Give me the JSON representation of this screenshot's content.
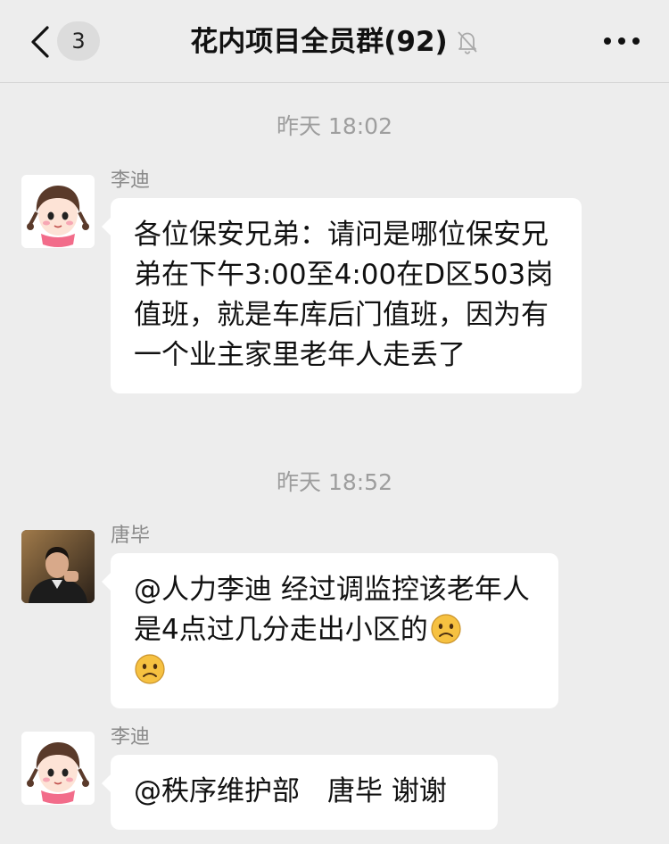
{
  "header": {
    "unread_count": "3",
    "title": "花内项目全员群(92)",
    "back_icon": "chevron-left-icon",
    "mute_icon": "bell-off-icon",
    "more_icon": "more-dots-icon"
  },
  "messages": [
    {
      "timestamp": "昨天 18:02"
    },
    {
      "sender": "李迪",
      "avatar": "girl-cartoon-avatar",
      "text": "各位保安兄弟：请问是哪位保安兄弟在下午3:00至4:00在D区503岗值班，就是车库后门值班，因为有一个业主家里老年人走丢了"
    },
    {
      "timestamp": "昨天 18:52"
    },
    {
      "sender": "唐毕",
      "avatar": "man-photo-avatar",
      "text": "@人力李迪 经过调监控该老年人是4点过几分走出小区的",
      "emoji": [
        "frown-emoji",
        "frown-emoji"
      ]
    },
    {
      "sender": "李迪",
      "avatar": "girl-cartoon-avatar",
      "text": "@秩序维护部　唐毕 谢谢"
    }
  ],
  "colors": {
    "background": "#ededed",
    "bubble": "#ffffff",
    "timestamp_text": "#9e9e9e",
    "sender_text": "#8a8a8a"
  }
}
